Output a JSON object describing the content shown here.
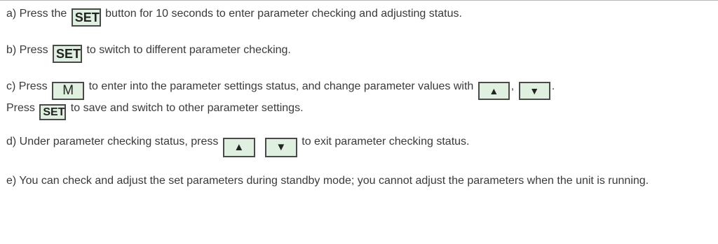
{
  "items": {
    "a": {
      "prefix": "a) Press the ",
      "key": "SET",
      "suffix": " button for 10 seconds to enter parameter checking and adjusting status."
    },
    "b": {
      "prefix": "b) Press ",
      "key": "SET",
      "suffix": " to switch to different parameter checking."
    },
    "c": {
      "prefix": "c) Press ",
      "key_m": "M",
      "middle": " to enter into the parameter settings status, and change parameter values with ",
      "key_up": "▲",
      "comma": ",",
      "key_down": "▼",
      "period": ".",
      "line2_prefix": "Press ",
      "key_set": "SET",
      "line2_suffix": " to save and switch to other parameter settings."
    },
    "d": {
      "prefix": "d) Under parameter checking status, press ",
      "key_up": "▲",
      "key_down": "▼",
      "suffix": " to exit parameter checking status."
    },
    "e": {
      "text": "e) You can check and adjust the set parameters during standby mode; you cannot adjust the parameters when the unit is running."
    }
  },
  "icons": {
    "up": "up-triangle-icon",
    "down": "down-triangle-icon"
  },
  "colors": {
    "key_background": "#dff0e1",
    "key_border": "#4a4a4a",
    "text": "#3a3a3a"
  }
}
